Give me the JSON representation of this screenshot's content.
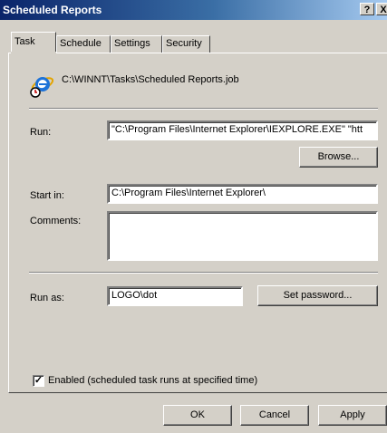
{
  "window": {
    "title": "Scheduled Reports",
    "help_label": "?",
    "close_label": "X"
  },
  "tabs": [
    {
      "label": "Task",
      "active": true
    },
    {
      "label": "Schedule",
      "active": false
    },
    {
      "label": "Settings",
      "active": false
    },
    {
      "label": "Security",
      "active": false
    }
  ],
  "task": {
    "file_path": "C:\\WINNT\\Tasks\\Scheduled Reports.job",
    "icon": "internet-explorer-scheduled-task-icon",
    "run": {
      "label": "Run:",
      "value": "\"C:\\Program Files\\Internet Explorer\\IEXPLORE.EXE\" \"htt"
    },
    "browse_label": "Browse...",
    "start_in": {
      "label": "Start in:",
      "value": "C:\\Program Files\\Internet Explorer\\"
    },
    "comments": {
      "label": "Comments:",
      "value": ""
    },
    "run_as": {
      "label": "Run as:",
      "value": "LOGO\\dot"
    },
    "set_password_label": "Set password...",
    "enabled": {
      "label": "Enabled (scheduled task runs at specified time)",
      "checked": true
    }
  },
  "footer": {
    "ok_label": "OK",
    "cancel_label": "Cancel",
    "apply_label": "Apply"
  },
  "colors": {
    "title_bar_start": "#0a246a",
    "title_bar_end": "#a6caf0",
    "face": "#d4d0c8"
  }
}
